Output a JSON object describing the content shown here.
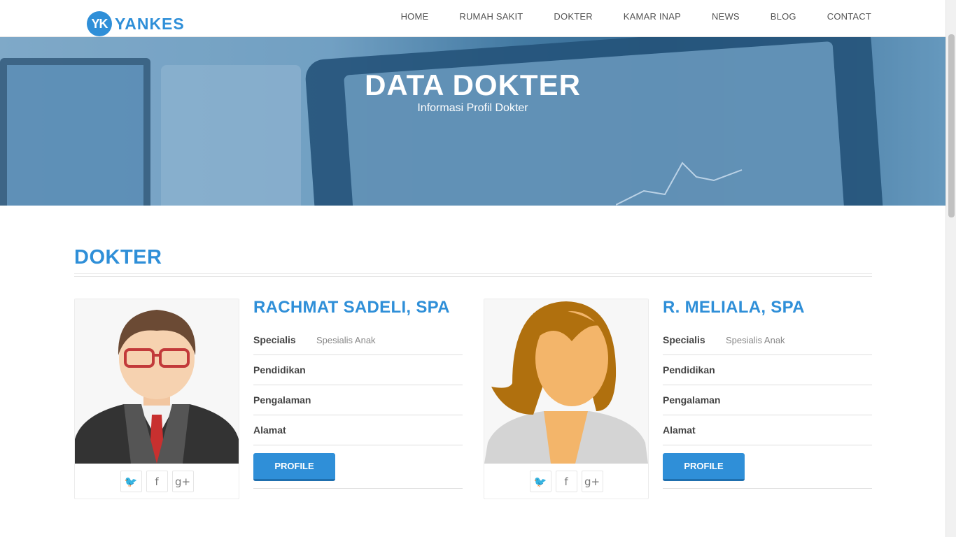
{
  "brand": {
    "mark": "YK",
    "name": "YANKES"
  },
  "nav": [
    "HOME",
    "RUMAH SAKIT",
    "DOKTER",
    "KAMAR INAP",
    "NEWS",
    "BLOG",
    "CONTACT"
  ],
  "hero": {
    "title": "DATA DOKTER",
    "subtitle": "Informasi Profil Dokter"
  },
  "section": {
    "title": "DOKTER"
  },
  "doctors": [
    {
      "name": "RACHMAT SADELI, SPA",
      "fields": [
        {
          "label": "Specialis",
          "value": "Spesialis Anak"
        },
        {
          "label": "Pendidikan",
          "value": ""
        },
        {
          "label": "Pengalaman",
          "value": ""
        },
        {
          "label": "Alamat",
          "value": ""
        }
      ],
      "button": "PROFILE",
      "socials": [
        "twitter-icon",
        "facebook-icon",
        "google-plus-icon"
      ]
    },
    {
      "name": "R. MELIALA, SPA",
      "fields": [
        {
          "label": "Specialis",
          "value": "Spesialis Anak"
        },
        {
          "label": "Pendidikan",
          "value": ""
        },
        {
          "label": "Pengalaman",
          "value": ""
        },
        {
          "label": "Alamat",
          "value": ""
        }
      ],
      "button": "PROFILE",
      "socials": [
        "twitter-icon",
        "facebook-icon",
        "google-plus-icon"
      ]
    }
  ],
  "colors": {
    "accent": "#2f8fd8",
    "button_shadow": "#1f6fae"
  }
}
